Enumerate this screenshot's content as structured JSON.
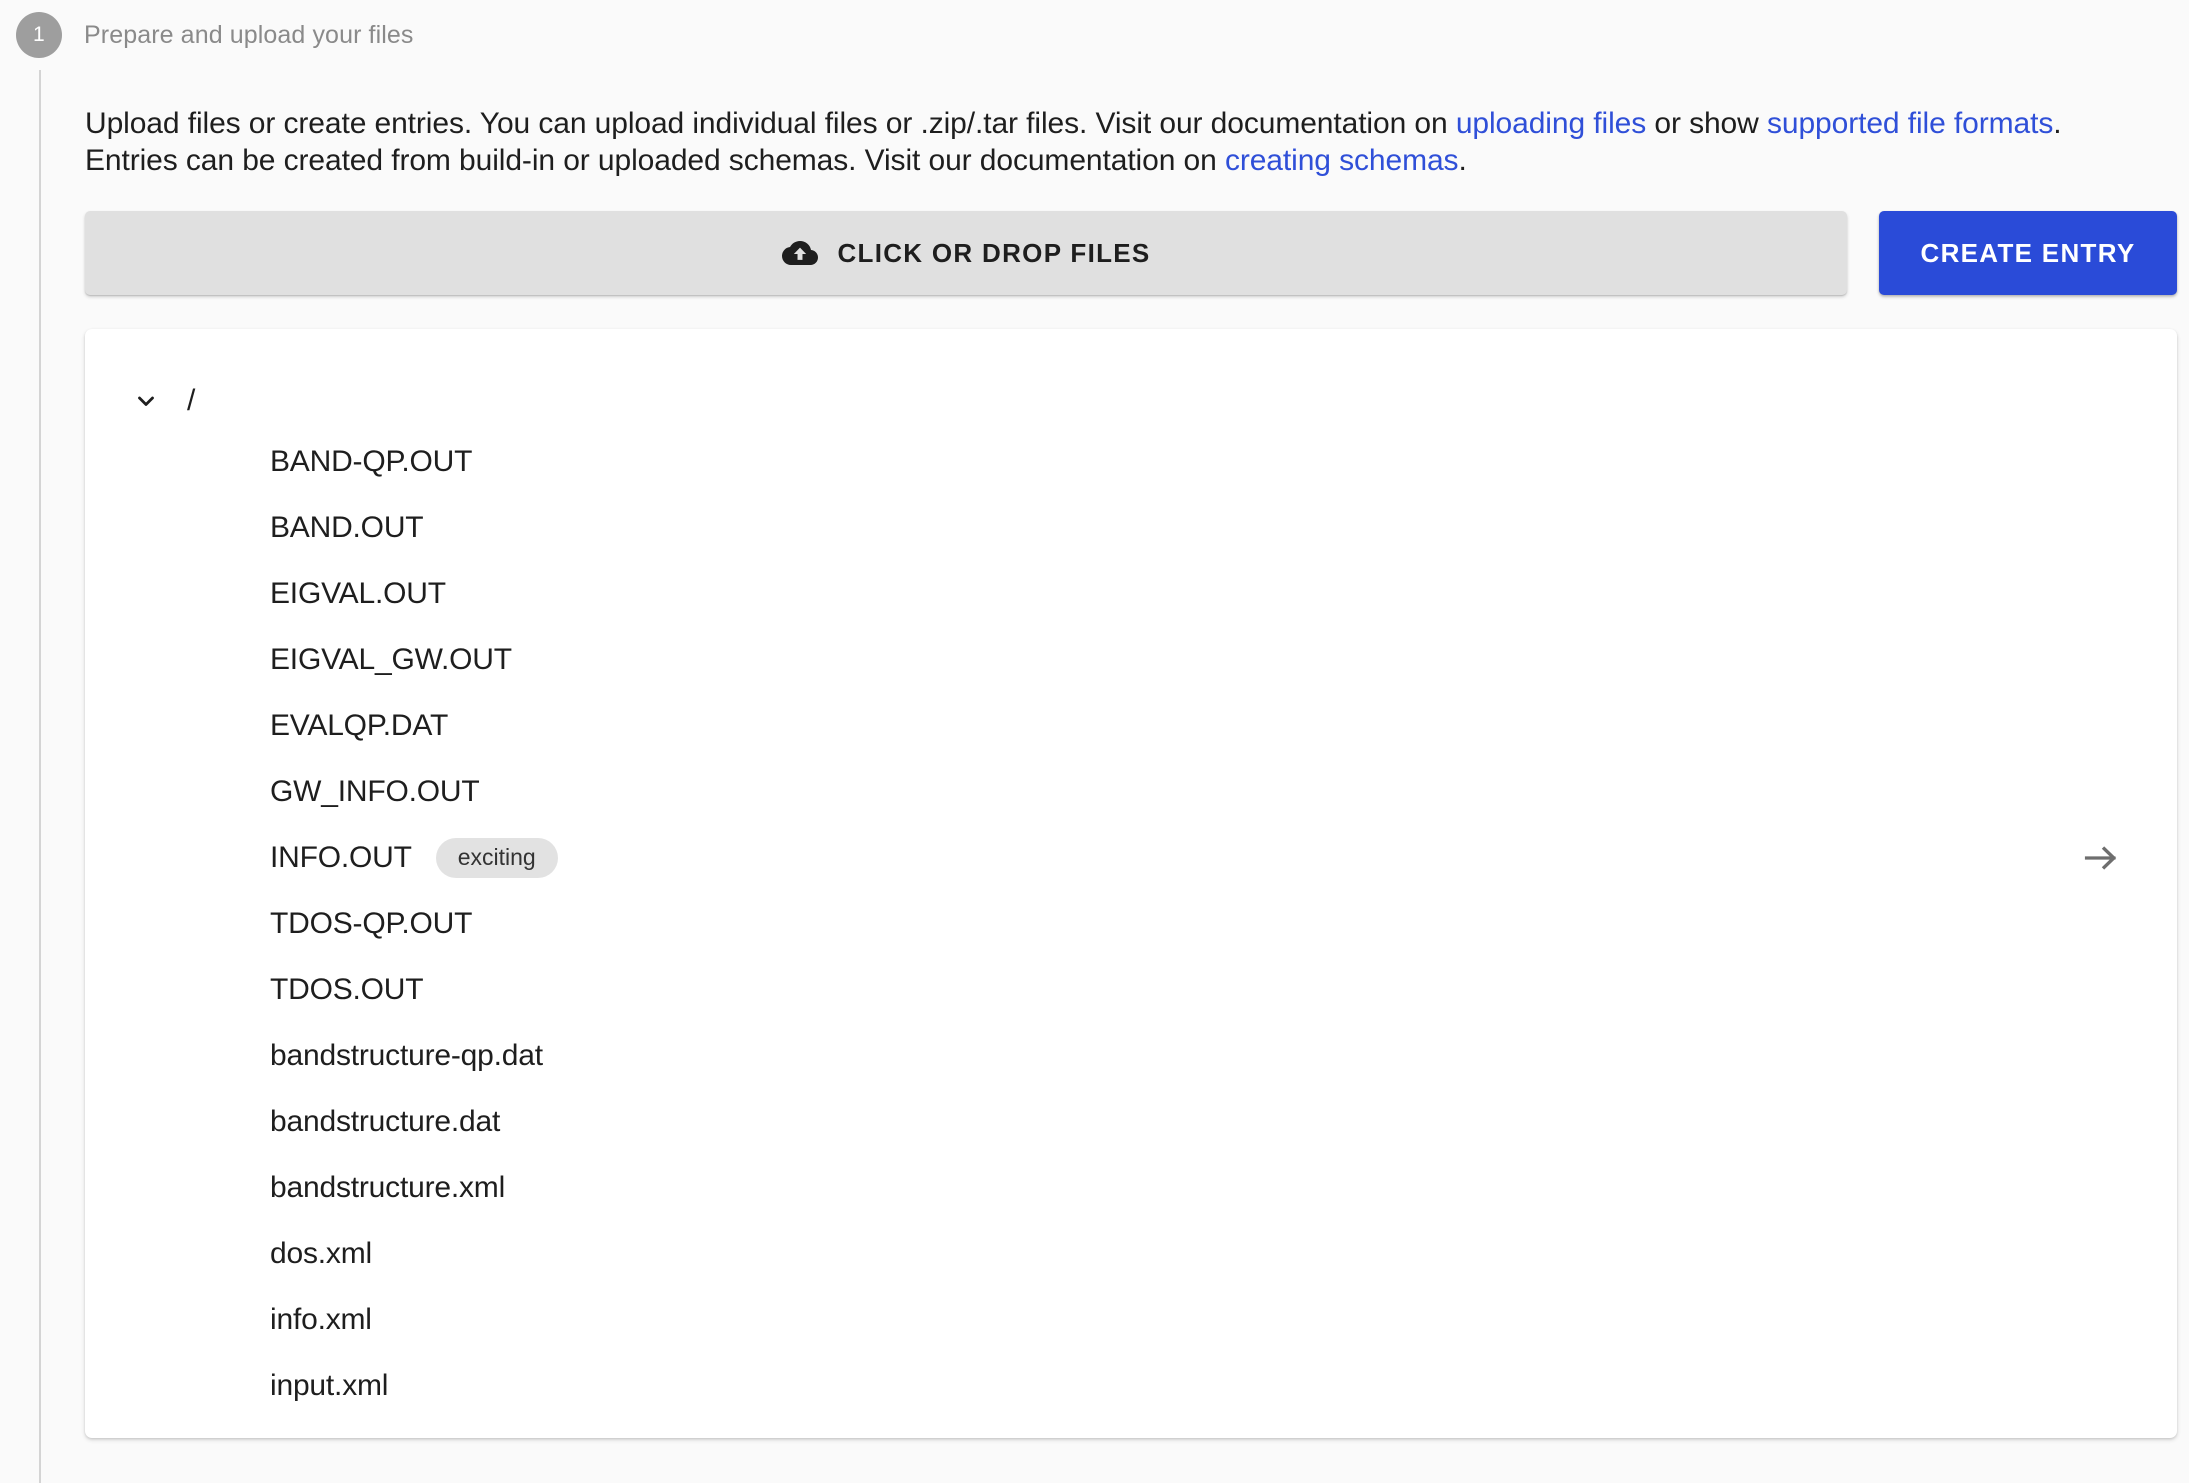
{
  "step": {
    "number": "1",
    "title": "Prepare and upload your files"
  },
  "intro": {
    "part1": "Upload files or create entries. You can upload individual files or .zip/.tar files. Visit our documentation on ",
    "link_uploading_files": "uploading files",
    "part2": " or show ",
    "link_supported_formats": "supported file formats",
    "part3": ". Entries can be created from build-in or uploaded schemas. Visit our documentation on ",
    "link_creating_schemas": "creating schemas",
    "part4": "."
  },
  "actions": {
    "dropzone_label": "CLICK OR DROP FILES",
    "dropzone_icon": "cloud-upload-icon",
    "create_entry_label": "CREATE ENTRY",
    "accent_color": "#2a4bd8",
    "dropzone_color": "#e0e0e0"
  },
  "file_browser": {
    "root_label": "/",
    "root_expanded": true,
    "chevron_icon": "chevron-down-icon",
    "navigate_icon": "arrow-right-icon",
    "files": [
      {
        "name": "BAND-QP.OUT",
        "chip": null,
        "has_arrow": false
      },
      {
        "name": "BAND.OUT",
        "chip": null,
        "has_arrow": false
      },
      {
        "name": "EIGVAL.OUT",
        "chip": null,
        "has_arrow": false
      },
      {
        "name": "EIGVAL_GW.OUT",
        "chip": null,
        "has_arrow": false
      },
      {
        "name": "EVALQP.DAT",
        "chip": null,
        "has_arrow": false
      },
      {
        "name": "GW_INFO.OUT",
        "chip": null,
        "has_arrow": false
      },
      {
        "name": "INFO.OUT",
        "chip": "exciting",
        "has_arrow": true
      },
      {
        "name": "TDOS-QP.OUT",
        "chip": null,
        "has_arrow": false
      },
      {
        "name": "TDOS.OUT",
        "chip": null,
        "has_arrow": false
      },
      {
        "name": "bandstructure-qp.dat",
        "chip": null,
        "has_arrow": false
      },
      {
        "name": "bandstructure.dat",
        "chip": null,
        "has_arrow": false
      },
      {
        "name": "bandstructure.xml",
        "chip": null,
        "has_arrow": false
      },
      {
        "name": "dos.xml",
        "chip": null,
        "has_arrow": false
      },
      {
        "name": "info.xml",
        "chip": null,
        "has_arrow": false
      },
      {
        "name": "input.xml",
        "chip": null,
        "has_arrow": false
      }
    ]
  }
}
